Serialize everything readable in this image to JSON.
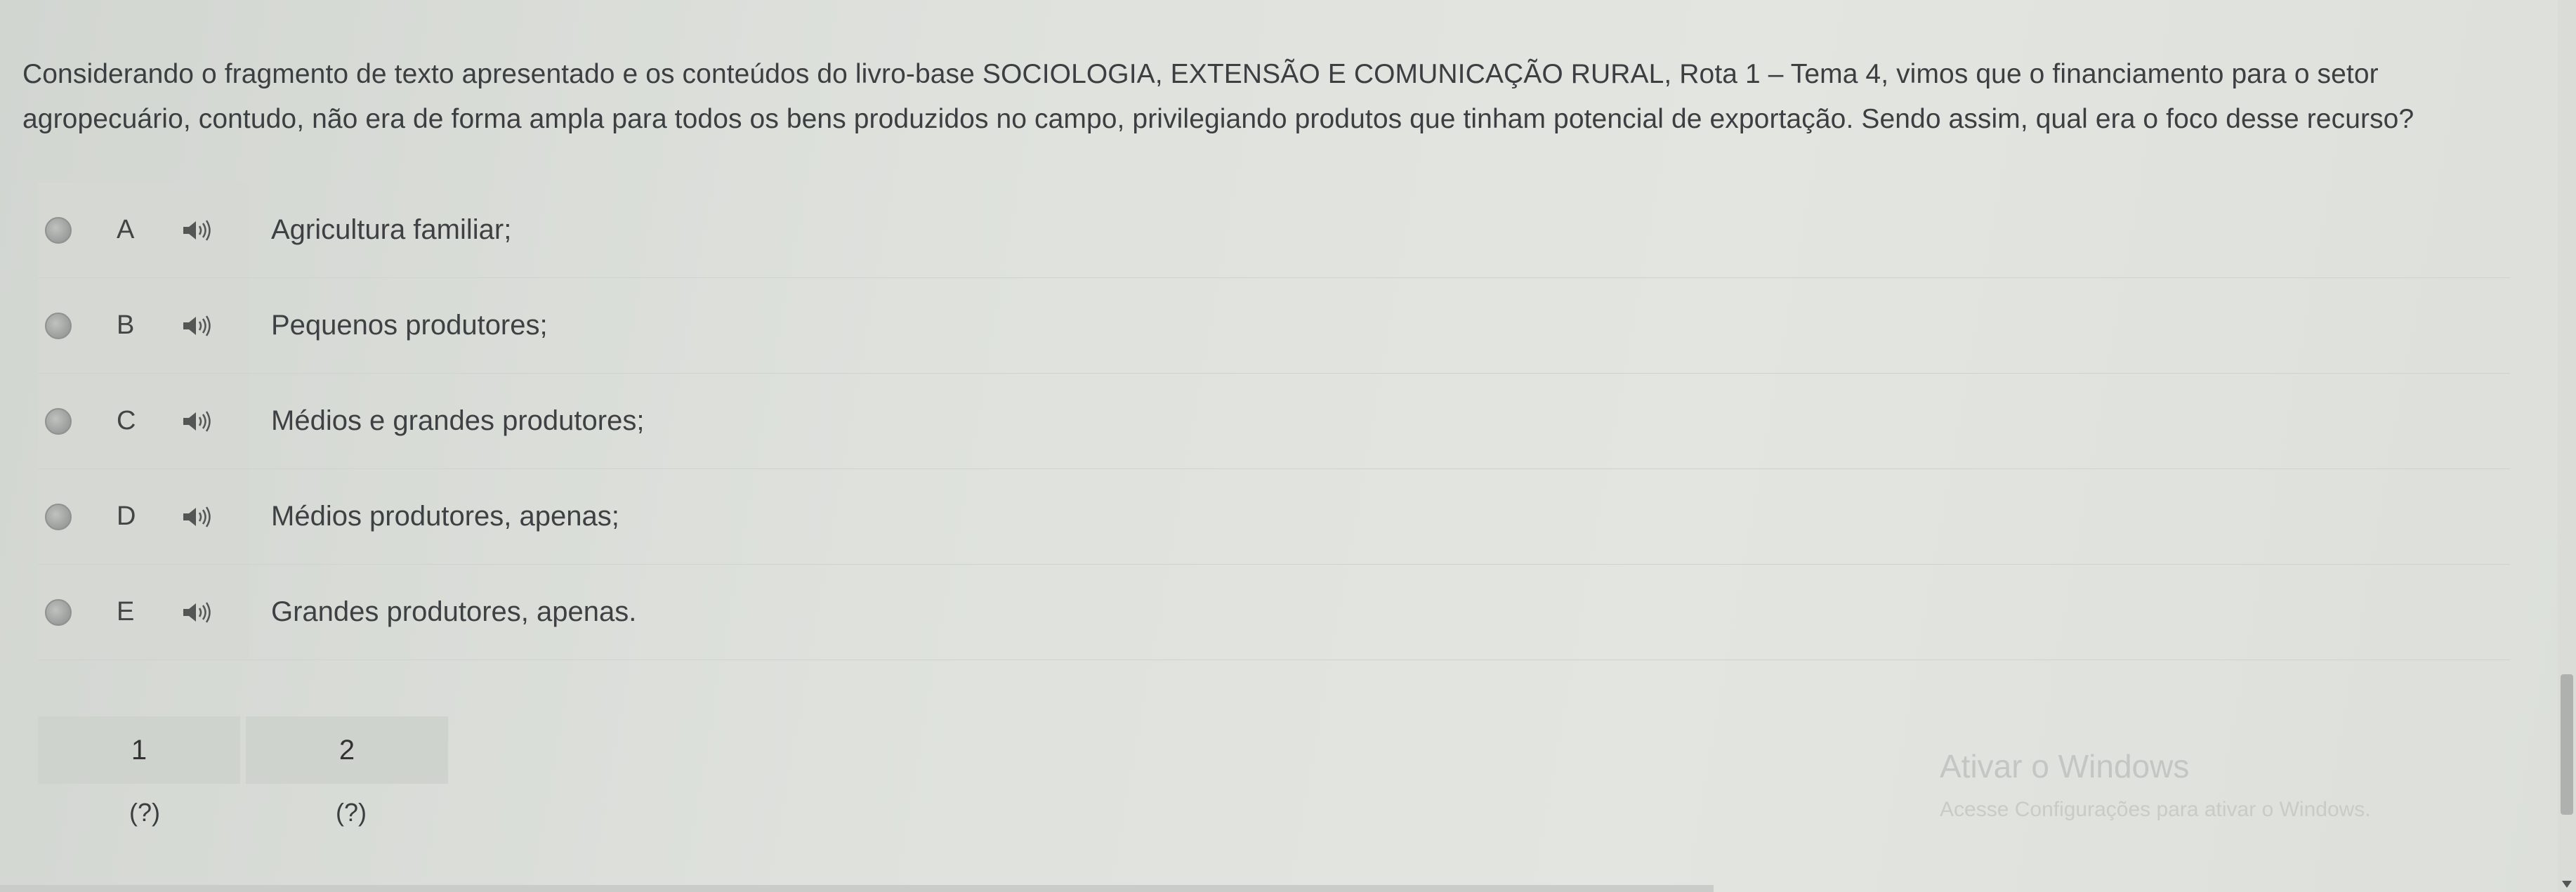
{
  "question": {
    "text": "Considerando o fragmento de texto apresentado e os conteúdos do livro-base SOCIOLOGIA, EXTENSÃO E COMUNICAÇÃO RURAL, Rota 1 – Tema 4, vimos que o financiamento para o setor agropecuário, contudo, não era de forma ampla para todos os bens produzidos no campo, privilegiando produtos que tinham potencial de exportação. Sendo assim, qual era o foco desse recurso?"
  },
  "options": [
    {
      "letter": "A",
      "text": "Agricultura familiar;",
      "icon": "speaker-icon"
    },
    {
      "letter": "B",
      "text": "Pequenos produtores;",
      "icon": "speaker-icon"
    },
    {
      "letter": "C",
      "text": "Médios e grandes produtores;",
      "icon": "speaker-icon"
    },
    {
      "letter": "D",
      "text": "Médios produtores, apenas;",
      "icon": "speaker-icon"
    },
    {
      "letter": "E",
      "text": "Grandes produtores, apenas.",
      "icon": "speaker-icon"
    }
  ],
  "navigation": {
    "q1": {
      "label": "1",
      "status": "(?)"
    },
    "q2": {
      "label": "2",
      "status": "(?)"
    }
  },
  "watermark": {
    "title": "Ativar o Windows",
    "subtitle": "Acesse Configurações para ativar o Windows."
  }
}
